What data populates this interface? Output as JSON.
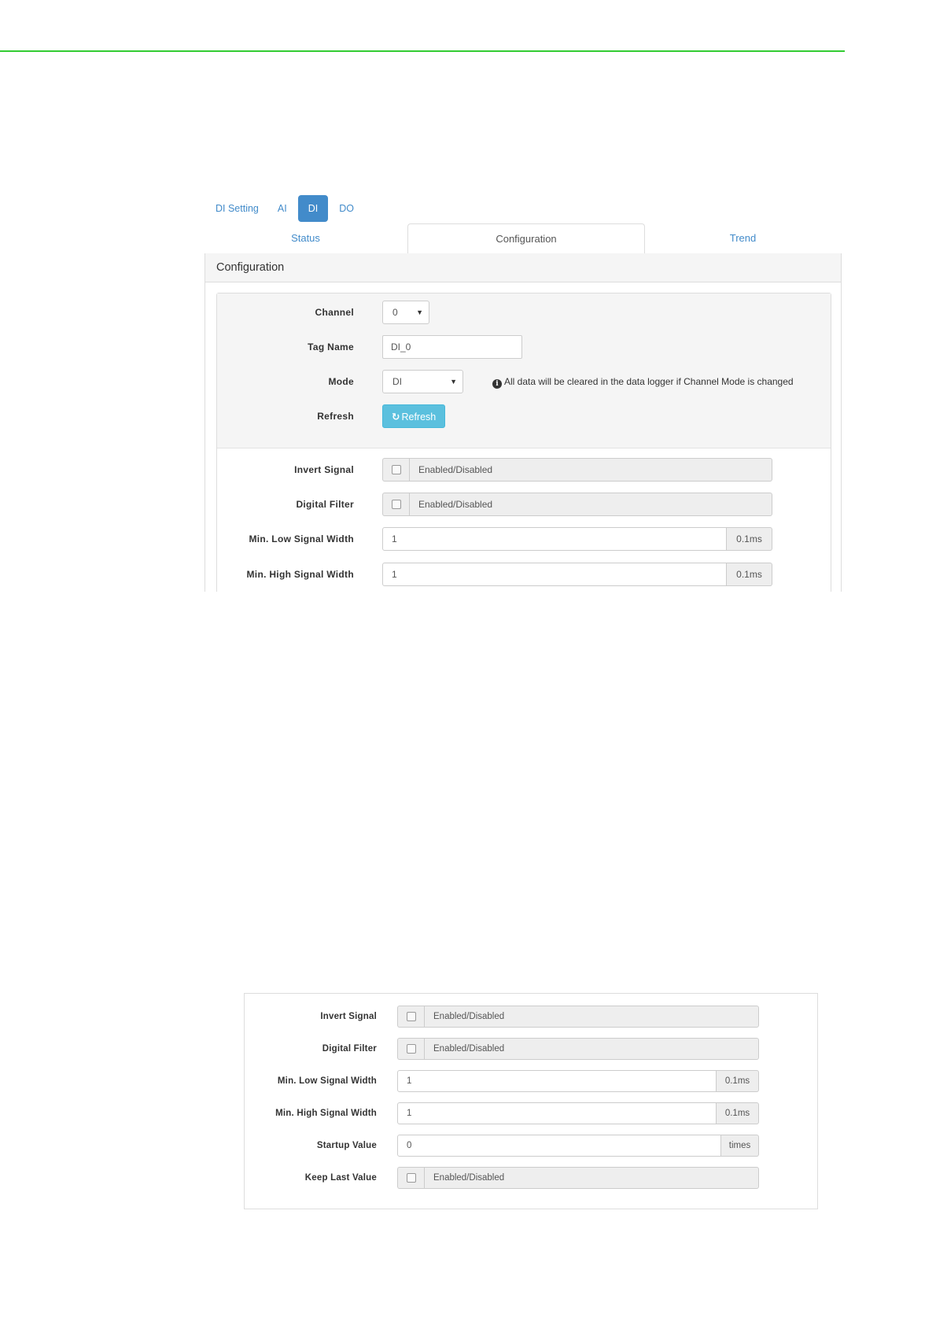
{
  "screenshot1": {
    "top_tabs": [
      "DI Setting",
      "AI",
      "DI",
      "DO"
    ],
    "active_top_tab": "DI",
    "sub_tabs": [
      "Status",
      "Configuration",
      "Trend"
    ],
    "active_sub_tab": "Configuration",
    "panel_title": "Configuration",
    "channel": {
      "label": "Channel",
      "value": "0"
    },
    "tag_name": {
      "label": "Tag Name",
      "value": "DI_0"
    },
    "mode": {
      "label": "Mode",
      "value": "DI",
      "hint": "All data will be cleared in the data logger if Channel Mode is changed"
    },
    "refresh": {
      "label": "Refresh",
      "button_label": "Refresh"
    },
    "invert_signal": {
      "label": "Invert Signal",
      "text": "Enabled/Disabled"
    },
    "digital_filter": {
      "label": "Digital Filter",
      "text": "Enabled/Disabled"
    },
    "min_low": {
      "label": "Min. Low Signal Width",
      "value": "1",
      "unit": "0.1ms"
    },
    "min_high": {
      "label": "Min. High Signal Width",
      "value": "1",
      "unit": "0.1ms"
    }
  },
  "screenshot2": {
    "invert_signal": {
      "label": "Invert Signal",
      "text": "Enabled/Disabled"
    },
    "digital_filter": {
      "label": "Digital Filter",
      "text": "Enabled/Disabled"
    },
    "min_low": {
      "label": "Min. Low Signal Width",
      "value": "1",
      "unit": "0.1ms"
    },
    "min_high": {
      "label": "Min. High Signal Width",
      "value": "1",
      "unit": "0.1ms"
    },
    "startup_value": {
      "label": "Startup Value",
      "value": "0",
      "unit": "times"
    },
    "keep_last_value": {
      "label": "Keep Last Value",
      "text": "Enabled/Disabled"
    }
  },
  "colors": {
    "top_rule": "#33cc33",
    "primary": "#428bca",
    "info_button": "#5bc0de"
  },
  "icons": {
    "hint_icon": "info-circle",
    "refresh_icon": "refresh"
  }
}
